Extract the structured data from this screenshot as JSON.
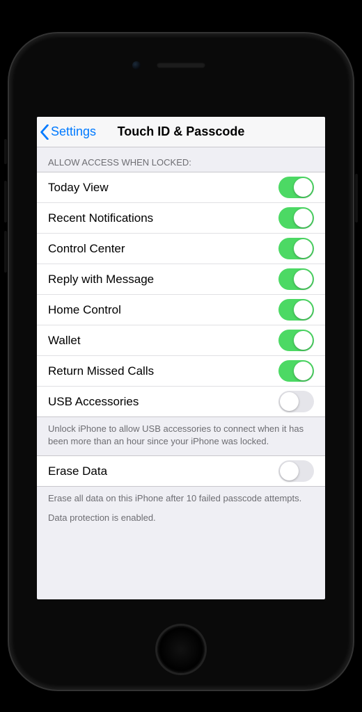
{
  "nav": {
    "back_label": "Settings",
    "title": "Touch ID & Passcode"
  },
  "section_access": {
    "header": "Allow Access When Locked:",
    "rows": [
      {
        "label": "Today View",
        "on": true
      },
      {
        "label": "Recent Notifications",
        "on": true
      },
      {
        "label": "Control Center",
        "on": true
      },
      {
        "label": "Reply with Message",
        "on": true
      },
      {
        "label": "Home Control",
        "on": true
      },
      {
        "label": "Wallet",
        "on": true
      },
      {
        "label": "Return Missed Calls",
        "on": true
      },
      {
        "label": "USB Accessories",
        "on": false
      }
    ],
    "footer": "Unlock iPhone to allow USB accessories to connect when it has been more than an hour since your iPhone was locked."
  },
  "section_erase": {
    "rows": [
      {
        "label": "Erase Data",
        "on": false
      }
    ],
    "footer_line1": "Erase all data on this iPhone after 10 failed passcode attempts.",
    "footer_line2": "Data protection is enabled."
  }
}
